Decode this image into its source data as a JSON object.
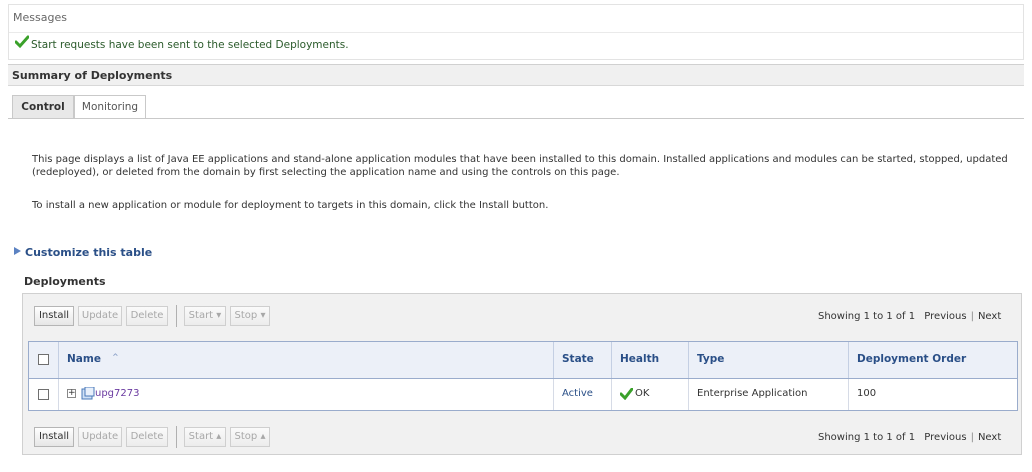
{
  "messages": {
    "header": "Messages",
    "text": "Start requests have been sent to the selected Deployments."
  },
  "summary": {
    "title": "Summary of Deployments"
  },
  "tabs": [
    {
      "label": "Control",
      "active": true
    },
    {
      "label": "Monitoring",
      "active": false
    }
  ],
  "description": {
    "line1": "This page displays a list of Java EE applications and stand-alone application modules that have been installed to this domain. Installed applications and modules can be started, stopped, updated (redeployed), or deleted from the domain by first selecting the application name and using the controls on this page.",
    "line2": "To install a new application or module for deployment to targets in this domain, click the Install button."
  },
  "customize_link": "Customize this table",
  "deployments": {
    "title": "Deployments",
    "toolbar": {
      "install": "Install",
      "update": "Update",
      "delete": "Delete",
      "start": "Start",
      "stop": "Stop"
    },
    "paging": {
      "showing": "Showing 1 to 1 of 1",
      "previous": "Previous",
      "next": "Next"
    },
    "columns": [
      "Name",
      "State",
      "Health",
      "Type",
      "Deployment Order"
    ],
    "rows": [
      {
        "name": "upg7273",
        "state": "Active",
        "health": "OK",
        "type": "Enterprise Application",
        "order": "100"
      }
    ]
  },
  "colors": {
    "link": "#2a4f87",
    "header_bg": "#ecf0f8",
    "ok_green": "#3aa12a",
    "state_blue": "#2a4f87",
    "name_purple": "#6a3aa0"
  }
}
